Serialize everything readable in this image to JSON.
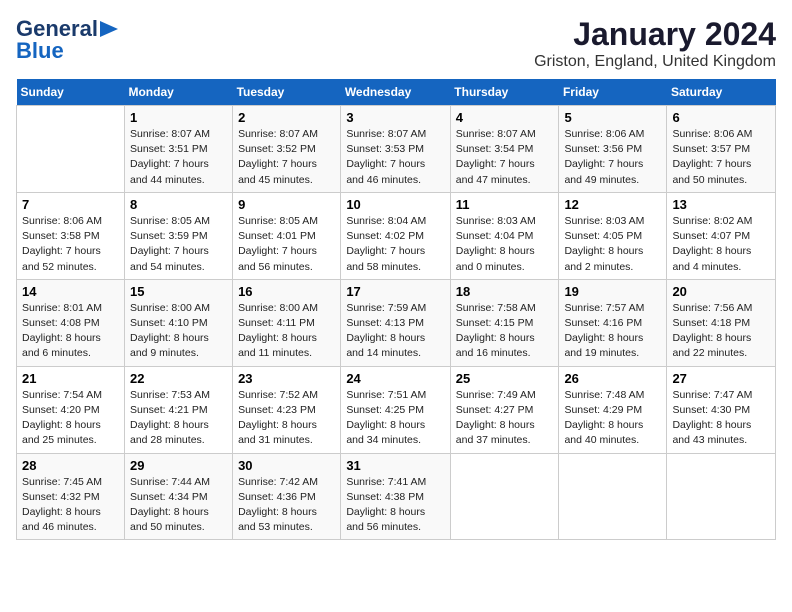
{
  "logo": {
    "line1": "General",
    "line2": "Blue"
  },
  "title": "January 2024",
  "subtitle": "Griston, England, United Kingdom",
  "days_header": [
    "Sunday",
    "Monday",
    "Tuesday",
    "Wednesday",
    "Thursday",
    "Friday",
    "Saturday"
  ],
  "weeks": [
    [
      {
        "day": "",
        "sunrise": "",
        "sunset": "",
        "daylight": ""
      },
      {
        "day": "1",
        "sunrise": "Sunrise: 8:07 AM",
        "sunset": "Sunset: 3:51 PM",
        "daylight": "Daylight: 7 hours and 44 minutes."
      },
      {
        "day": "2",
        "sunrise": "Sunrise: 8:07 AM",
        "sunset": "Sunset: 3:52 PM",
        "daylight": "Daylight: 7 hours and 45 minutes."
      },
      {
        "day": "3",
        "sunrise": "Sunrise: 8:07 AM",
        "sunset": "Sunset: 3:53 PM",
        "daylight": "Daylight: 7 hours and 46 minutes."
      },
      {
        "day": "4",
        "sunrise": "Sunrise: 8:07 AM",
        "sunset": "Sunset: 3:54 PM",
        "daylight": "Daylight: 7 hours and 47 minutes."
      },
      {
        "day": "5",
        "sunrise": "Sunrise: 8:06 AM",
        "sunset": "Sunset: 3:56 PM",
        "daylight": "Daylight: 7 hours and 49 minutes."
      },
      {
        "day": "6",
        "sunrise": "Sunrise: 8:06 AM",
        "sunset": "Sunset: 3:57 PM",
        "daylight": "Daylight: 7 hours and 50 minutes."
      }
    ],
    [
      {
        "day": "7",
        "sunrise": "Sunrise: 8:06 AM",
        "sunset": "Sunset: 3:58 PM",
        "daylight": "Daylight: 7 hours and 52 minutes."
      },
      {
        "day": "8",
        "sunrise": "Sunrise: 8:05 AM",
        "sunset": "Sunset: 3:59 PM",
        "daylight": "Daylight: 7 hours and 54 minutes."
      },
      {
        "day": "9",
        "sunrise": "Sunrise: 8:05 AM",
        "sunset": "Sunset: 4:01 PM",
        "daylight": "Daylight: 7 hours and 56 minutes."
      },
      {
        "day": "10",
        "sunrise": "Sunrise: 8:04 AM",
        "sunset": "Sunset: 4:02 PM",
        "daylight": "Daylight: 7 hours and 58 minutes."
      },
      {
        "day": "11",
        "sunrise": "Sunrise: 8:03 AM",
        "sunset": "Sunset: 4:04 PM",
        "daylight": "Daylight: 8 hours and 0 minutes."
      },
      {
        "day": "12",
        "sunrise": "Sunrise: 8:03 AM",
        "sunset": "Sunset: 4:05 PM",
        "daylight": "Daylight: 8 hours and 2 minutes."
      },
      {
        "day": "13",
        "sunrise": "Sunrise: 8:02 AM",
        "sunset": "Sunset: 4:07 PM",
        "daylight": "Daylight: 8 hours and 4 minutes."
      }
    ],
    [
      {
        "day": "14",
        "sunrise": "Sunrise: 8:01 AM",
        "sunset": "Sunset: 4:08 PM",
        "daylight": "Daylight: 8 hours and 6 minutes."
      },
      {
        "day": "15",
        "sunrise": "Sunrise: 8:00 AM",
        "sunset": "Sunset: 4:10 PM",
        "daylight": "Daylight: 8 hours and 9 minutes."
      },
      {
        "day": "16",
        "sunrise": "Sunrise: 8:00 AM",
        "sunset": "Sunset: 4:11 PM",
        "daylight": "Daylight: 8 hours and 11 minutes."
      },
      {
        "day": "17",
        "sunrise": "Sunrise: 7:59 AM",
        "sunset": "Sunset: 4:13 PM",
        "daylight": "Daylight: 8 hours and 14 minutes."
      },
      {
        "day": "18",
        "sunrise": "Sunrise: 7:58 AM",
        "sunset": "Sunset: 4:15 PM",
        "daylight": "Daylight: 8 hours and 16 minutes."
      },
      {
        "day": "19",
        "sunrise": "Sunrise: 7:57 AM",
        "sunset": "Sunset: 4:16 PM",
        "daylight": "Daylight: 8 hours and 19 minutes."
      },
      {
        "day": "20",
        "sunrise": "Sunrise: 7:56 AM",
        "sunset": "Sunset: 4:18 PM",
        "daylight": "Daylight: 8 hours and 22 minutes."
      }
    ],
    [
      {
        "day": "21",
        "sunrise": "Sunrise: 7:54 AM",
        "sunset": "Sunset: 4:20 PM",
        "daylight": "Daylight: 8 hours and 25 minutes."
      },
      {
        "day": "22",
        "sunrise": "Sunrise: 7:53 AM",
        "sunset": "Sunset: 4:21 PM",
        "daylight": "Daylight: 8 hours and 28 minutes."
      },
      {
        "day": "23",
        "sunrise": "Sunrise: 7:52 AM",
        "sunset": "Sunset: 4:23 PM",
        "daylight": "Daylight: 8 hours and 31 minutes."
      },
      {
        "day": "24",
        "sunrise": "Sunrise: 7:51 AM",
        "sunset": "Sunset: 4:25 PM",
        "daylight": "Daylight: 8 hours and 34 minutes."
      },
      {
        "day": "25",
        "sunrise": "Sunrise: 7:49 AM",
        "sunset": "Sunset: 4:27 PM",
        "daylight": "Daylight: 8 hours and 37 minutes."
      },
      {
        "day": "26",
        "sunrise": "Sunrise: 7:48 AM",
        "sunset": "Sunset: 4:29 PM",
        "daylight": "Daylight: 8 hours and 40 minutes."
      },
      {
        "day": "27",
        "sunrise": "Sunrise: 7:47 AM",
        "sunset": "Sunset: 4:30 PM",
        "daylight": "Daylight: 8 hours and 43 minutes."
      }
    ],
    [
      {
        "day": "28",
        "sunrise": "Sunrise: 7:45 AM",
        "sunset": "Sunset: 4:32 PM",
        "daylight": "Daylight: 8 hours and 46 minutes."
      },
      {
        "day": "29",
        "sunrise": "Sunrise: 7:44 AM",
        "sunset": "Sunset: 4:34 PM",
        "daylight": "Daylight: 8 hours and 50 minutes."
      },
      {
        "day": "30",
        "sunrise": "Sunrise: 7:42 AM",
        "sunset": "Sunset: 4:36 PM",
        "daylight": "Daylight: 8 hours and 53 minutes."
      },
      {
        "day": "31",
        "sunrise": "Sunrise: 7:41 AM",
        "sunset": "Sunset: 4:38 PM",
        "daylight": "Daylight: 8 hours and 56 minutes."
      },
      {
        "day": "",
        "sunrise": "",
        "sunset": "",
        "daylight": ""
      },
      {
        "day": "",
        "sunrise": "",
        "sunset": "",
        "daylight": ""
      },
      {
        "day": "",
        "sunrise": "",
        "sunset": "",
        "daylight": ""
      }
    ]
  ]
}
